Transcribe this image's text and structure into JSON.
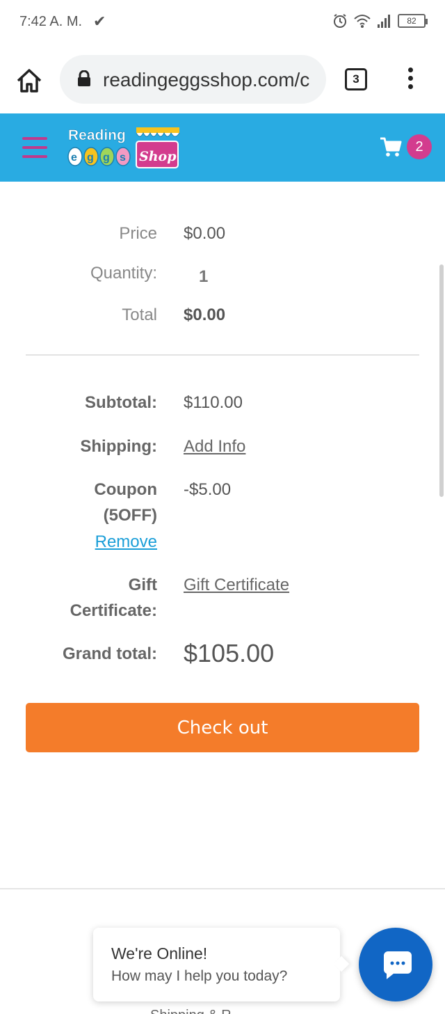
{
  "status_bar": {
    "time": "7:42 A. M.",
    "battery": "82"
  },
  "browser": {
    "url": "readingeggsshop.com/c",
    "tab_count": "3"
  },
  "header": {
    "logo_text_top": "Reading",
    "logo_text_eggs": "eggs",
    "logo_text_shop": "Shop",
    "cart_count": "2",
    "brand_color": "#29abe2",
    "accent_color": "#d33c8e"
  },
  "item": {
    "price_label": "Price",
    "price_value": "$0.00",
    "quantity_label": "Quantity:",
    "quantity_value": "1",
    "total_label": "Total",
    "total_value": "$0.00"
  },
  "summary": {
    "subtotal_label": "Subtotal:",
    "subtotal_value": "$110.00",
    "shipping_label": "Shipping:",
    "shipping_link": "Add Info",
    "coupon_label_line1": "Coupon",
    "coupon_label_line2": "(5OFF)",
    "coupon_remove": "Remove",
    "coupon_value": "-$5.00",
    "gift_label_line1": "Gift",
    "gift_label_line2": "Certificate:",
    "gift_link": "Gift Certificate",
    "grand_total_label": "Grand total:",
    "grand_total_value": "$105.00"
  },
  "checkout": {
    "label": "Check out",
    "color": "#f47c2a"
  },
  "chat": {
    "title": "We're Online!",
    "subtitle": "How may I help you today?"
  },
  "footer": {
    "partial_text": "Shipping & R..."
  }
}
